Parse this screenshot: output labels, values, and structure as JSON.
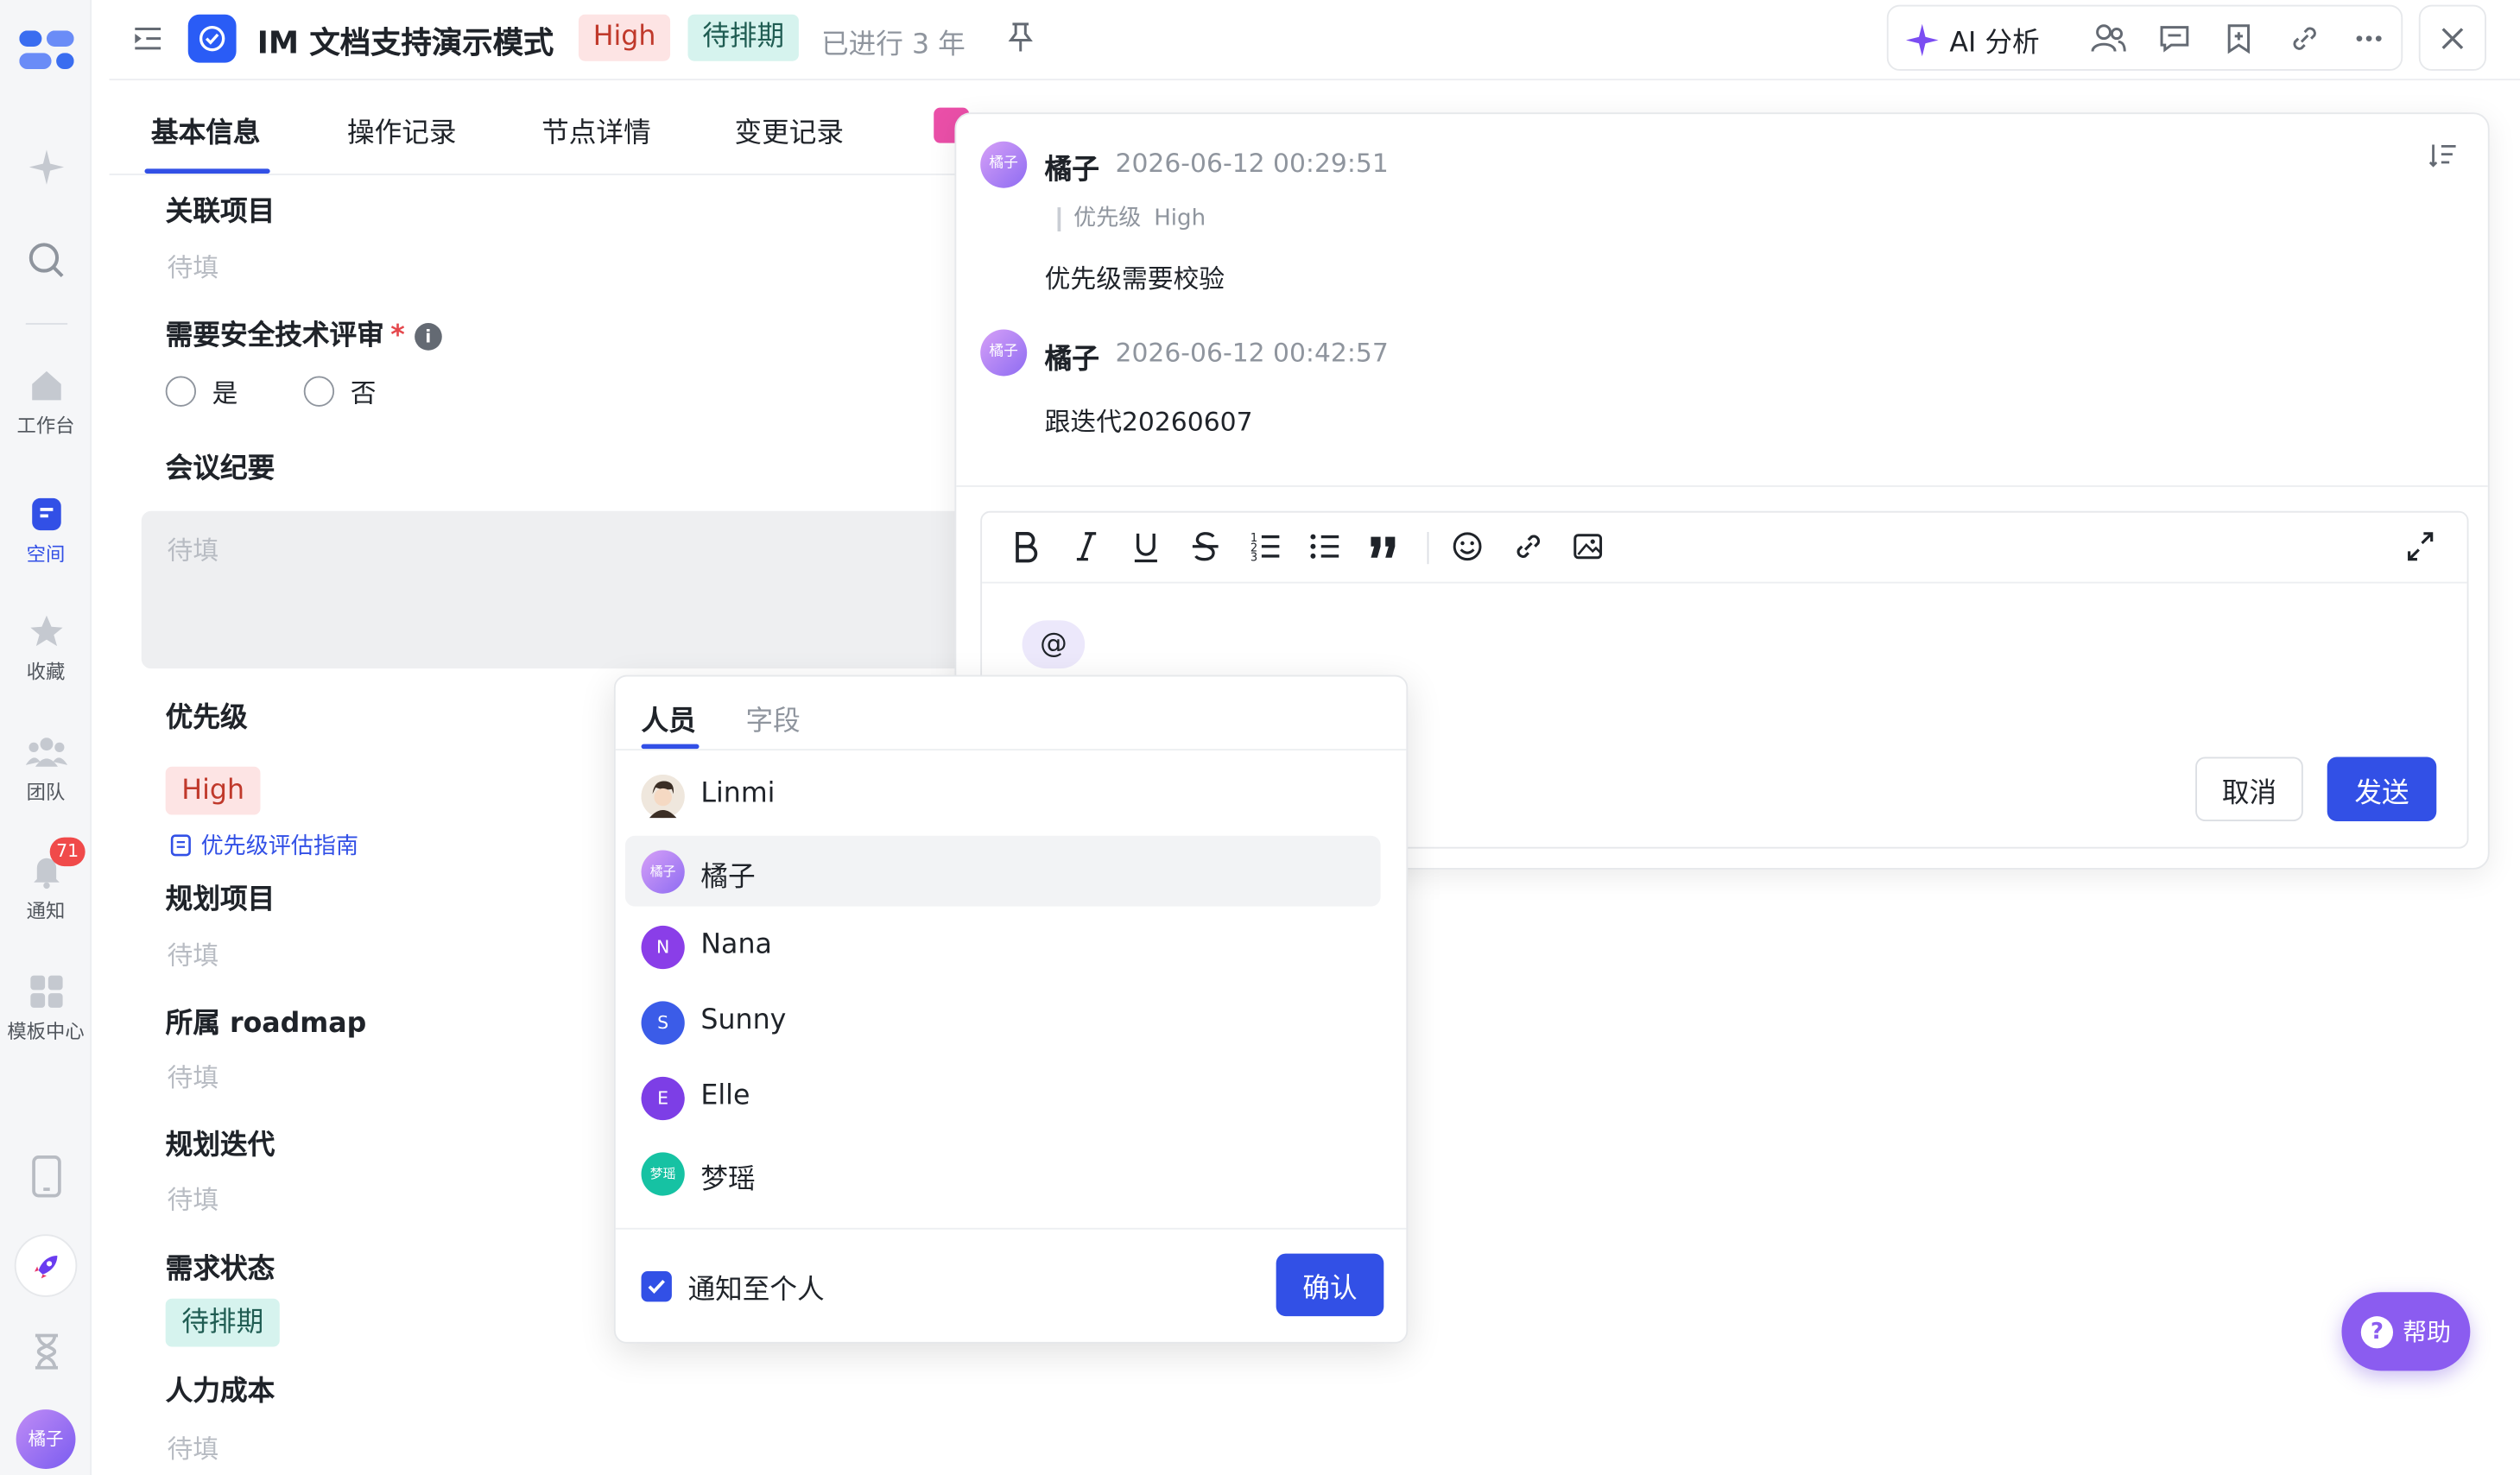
{
  "header": {
    "title": "IM 文档支持演示模式",
    "priority_tag": "High",
    "status_tag": "待排期",
    "elapsed": "已进行 3 年",
    "ai_label": "AI 分析"
  },
  "rail": {
    "items": [
      {
        "label": "工作台",
        "icon": "home-icon"
      },
      {
        "label": "空间",
        "icon": "space-icon"
      },
      {
        "label": "收藏",
        "icon": "star-icon"
      },
      {
        "label": "团队",
        "icon": "team-icon"
      },
      {
        "label": "通知",
        "icon": "bell-icon"
      },
      {
        "label": "模板中心",
        "icon": "template-icon"
      }
    ],
    "notification_count": "71",
    "avatar": "橘子"
  },
  "tabs": [
    "基本信息",
    "操作记录",
    "节点详情",
    "变更记录"
  ],
  "form": {
    "related_project": {
      "label": "关联项目",
      "value": "待填"
    },
    "security_review": {
      "label": "需要安全技术评审",
      "required": "*",
      "info": "i",
      "options": [
        "是",
        "否"
      ]
    },
    "meeting_notes": {
      "label": "会议纪要",
      "placeholder": "待填"
    },
    "priority": {
      "label": "优先级",
      "value": "High",
      "guide": "优先级评估指南"
    },
    "plan_project": {
      "label": "规划项目",
      "value": "待填"
    },
    "roadmap": {
      "label": "所属 roadmap",
      "value": "待填"
    },
    "plan_iteration": {
      "label": "规划迭代",
      "value": "待填"
    },
    "req_status": {
      "label": "需求状态",
      "value": "待排期"
    },
    "labor_cost": {
      "label": "人力成本",
      "value": "待填"
    }
  },
  "comments": [
    {
      "avatar": "橘子",
      "author": "橘子",
      "time": "2026-06-12 00:29:51",
      "field_label": "优先级",
      "field_value": "High",
      "text": "优先级需要校验"
    },
    {
      "avatar": "橘子",
      "author": "橘子",
      "time": "2026-06-12 00:42:57",
      "text": "跟迭代20260607"
    }
  ],
  "editor": {
    "content": "@",
    "cancel": "取消",
    "send": "发送"
  },
  "mention_popup": {
    "tabs": [
      "人员",
      "字段"
    ],
    "people": [
      {
        "name": "Linmi",
        "initial": "",
        "color": "#5a4a3e"
      },
      {
        "name": "橘子",
        "initial": "橘子",
        "color": "#a77cf3"
      },
      {
        "name": "Nana",
        "initial": "N",
        "color": "#8a3ee8"
      },
      {
        "name": "Sunny",
        "initial": "S",
        "color": "#3b5ce8"
      },
      {
        "name": "Elle",
        "initial": "E",
        "color": "#7d3ee6"
      },
      {
        "name": "梦瑶",
        "initial": "梦瑶",
        "color": "#16c2a3"
      }
    ],
    "notify_label": "通知至个人",
    "confirm": "确认"
  },
  "help": {
    "label": "帮助",
    "icon": "?"
  }
}
